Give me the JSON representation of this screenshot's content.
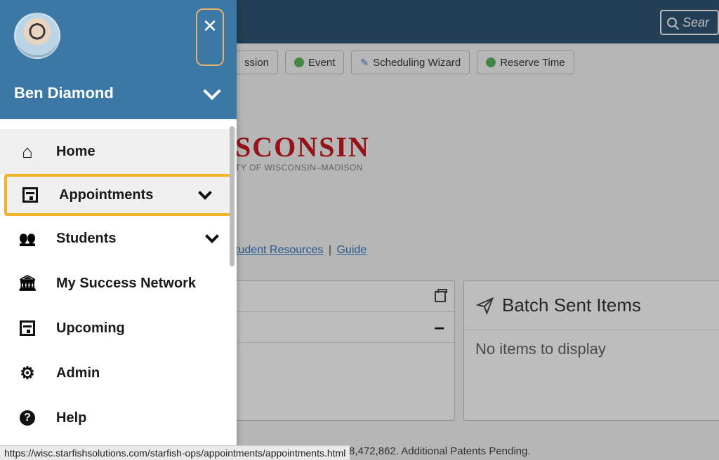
{
  "header": {
    "search_placeholder": "Sear"
  },
  "toolbar": {
    "session_btn": "ssion",
    "event_btn": "Event",
    "wizard_btn": "Scheduling Wizard",
    "reserve_btn": "Reserve Time"
  },
  "logo": {
    "wordmark": "SCONSIN",
    "subline": "TY OF WISCONSIN–MADISON"
  },
  "links": {
    "student_resources": "tudent Resources",
    "guide": "Guide",
    "sep": "|"
  },
  "batch_panel": {
    "title": "Batch Sent Items",
    "empty": "No items to display"
  },
  "collapse_panel": {
    "minus": "–"
  },
  "footer": {
    "patent": "8,472,862. Additional Patents Pending."
  },
  "drawer": {
    "user_name": "Ben Diamond",
    "close_label": "✕",
    "items": [
      {
        "label": "Home"
      },
      {
        "label": "Appointments"
      },
      {
        "label": "Students"
      },
      {
        "label": "My Success Network"
      },
      {
        "label": "Upcoming"
      },
      {
        "label": "Admin"
      },
      {
        "label": "Help"
      }
    ]
  },
  "status_url": "https://wisc.starfishsolutions.com/starfish-ops/appointments/appointments.html",
  "help_q": "?"
}
